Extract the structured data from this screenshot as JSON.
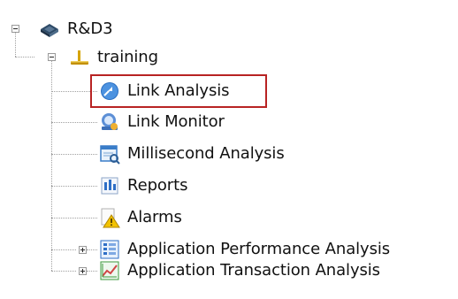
{
  "tree": {
    "root": {
      "label": "R&D3",
      "icon": "network-device-icon",
      "expanded": true
    },
    "group": {
      "label": "training",
      "icon": "network-segment-icon",
      "expanded": true
    },
    "items": [
      {
        "label": "Link Analysis",
        "icon": "link-analysis-icon",
        "selected": true
      },
      {
        "label": "Link Monitor",
        "icon": "link-monitor-icon"
      },
      {
        "label": "Millisecond Analysis",
        "icon": "millisecond-analysis-icon"
      },
      {
        "label": "Reports",
        "icon": "reports-icon"
      },
      {
        "label": "Alarms",
        "icon": "alarms-icon"
      },
      {
        "label": "Application Performance Analysis",
        "icon": "application-performance-icon",
        "expanded": false
      },
      {
        "label": "Application Transaction Analysis",
        "icon": "application-transaction-icon",
        "expanded": false
      }
    ]
  },
  "colors": {
    "selection_border": "#b82323",
    "connector": "#a0a0a0"
  }
}
